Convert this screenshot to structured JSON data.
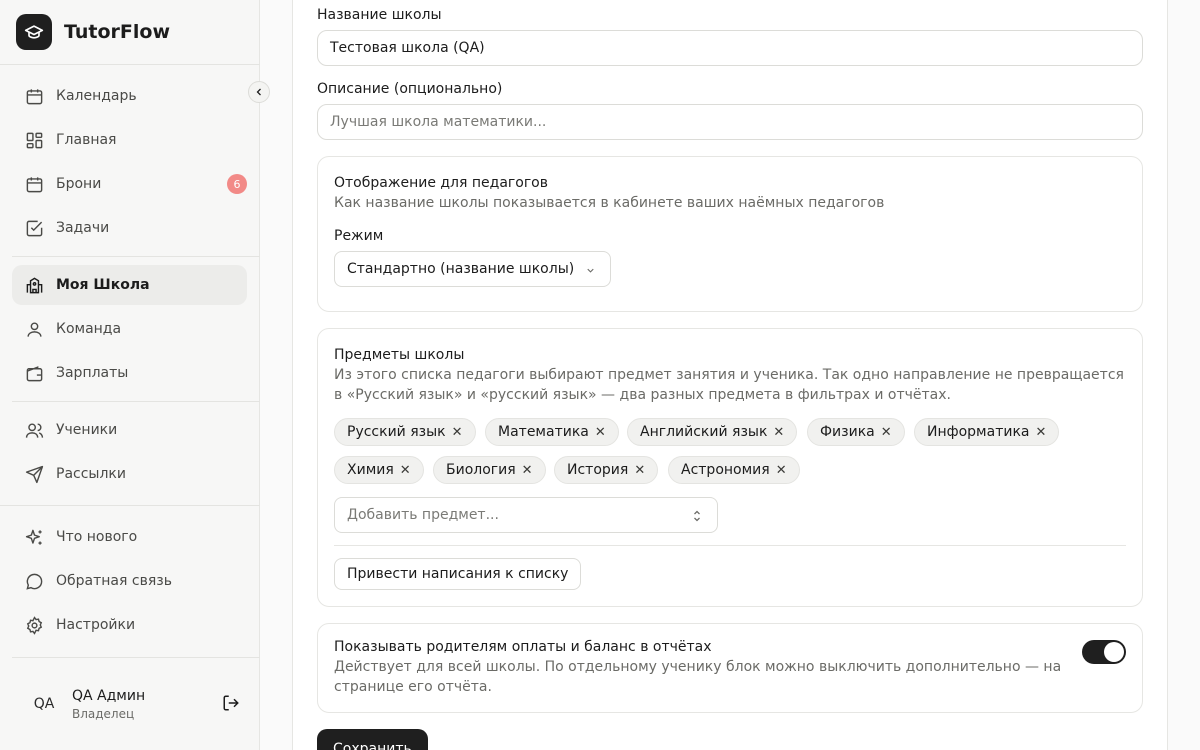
{
  "app": {
    "name": "TutorFlow"
  },
  "sidebar": {
    "items": [
      {
        "label": "Календарь",
        "icon": "calendar-icon"
      },
      {
        "label": "Главная",
        "icon": "dashboard-icon"
      },
      {
        "label": "Брони",
        "icon": "booking-icon",
        "badge": "6"
      },
      {
        "label": "Задачи",
        "icon": "tasks-icon"
      },
      {
        "label": "Моя Школа",
        "icon": "school-icon",
        "active": true
      },
      {
        "label": "Команда",
        "icon": "team-icon"
      },
      {
        "label": "Зарплаты",
        "icon": "wallet-icon"
      },
      {
        "label": "Ученики",
        "icon": "students-icon"
      },
      {
        "label": "Рассылки",
        "icon": "send-icon"
      },
      {
        "label": "Что нового",
        "icon": "sparkles-icon"
      },
      {
        "label": "Обратная связь",
        "icon": "message-icon"
      },
      {
        "label": "Настройки",
        "icon": "settings-icon"
      }
    ],
    "user": {
      "initials": "QA",
      "name": "QA Админ",
      "role": "Владелец"
    }
  },
  "form": {
    "school_name_label": "Название школы",
    "school_name_value": "Тестовая школа (QA)",
    "description_label": "Описание (опционально)",
    "description_placeholder": "Лучшая школа математики...",
    "display": {
      "title": "Отображение для педагогов",
      "desc": "Как название школы показывается в кабинете ваших наёмных педагогов",
      "mode_label": "Режим",
      "mode_value": "Стандартно (название школы)"
    },
    "subjects": {
      "title": "Предметы школы",
      "desc_line1": "Из этого списка педагоги выбирают предмет занятия и ученика. Так одно направление не превращается",
      "desc_line2": "в «Русский язык» и «русский язык» — два разных предмета в фильтрах и отчётах.",
      "chips": [
        "Русский язык",
        "Математика",
        "Английский язык",
        "Физика",
        "Информатика",
        "Химия",
        "Биология",
        "История",
        "Астрономия"
      ],
      "add_placeholder": "Добавить предмет...",
      "normalize_button": "Привести написания к списку"
    },
    "parents": {
      "title": "Показывать родителям оплаты и баланс в отчётах",
      "desc_line1": "Действует для всей школы. По отдельному ученику блок можно выключить дополнительно — на",
      "desc_line2": "странице его отчёта.",
      "enabled": true
    },
    "save_button": "Сохранить"
  },
  "colors": {
    "accent": "#1f1f1f",
    "badge": "#f28a87"
  }
}
